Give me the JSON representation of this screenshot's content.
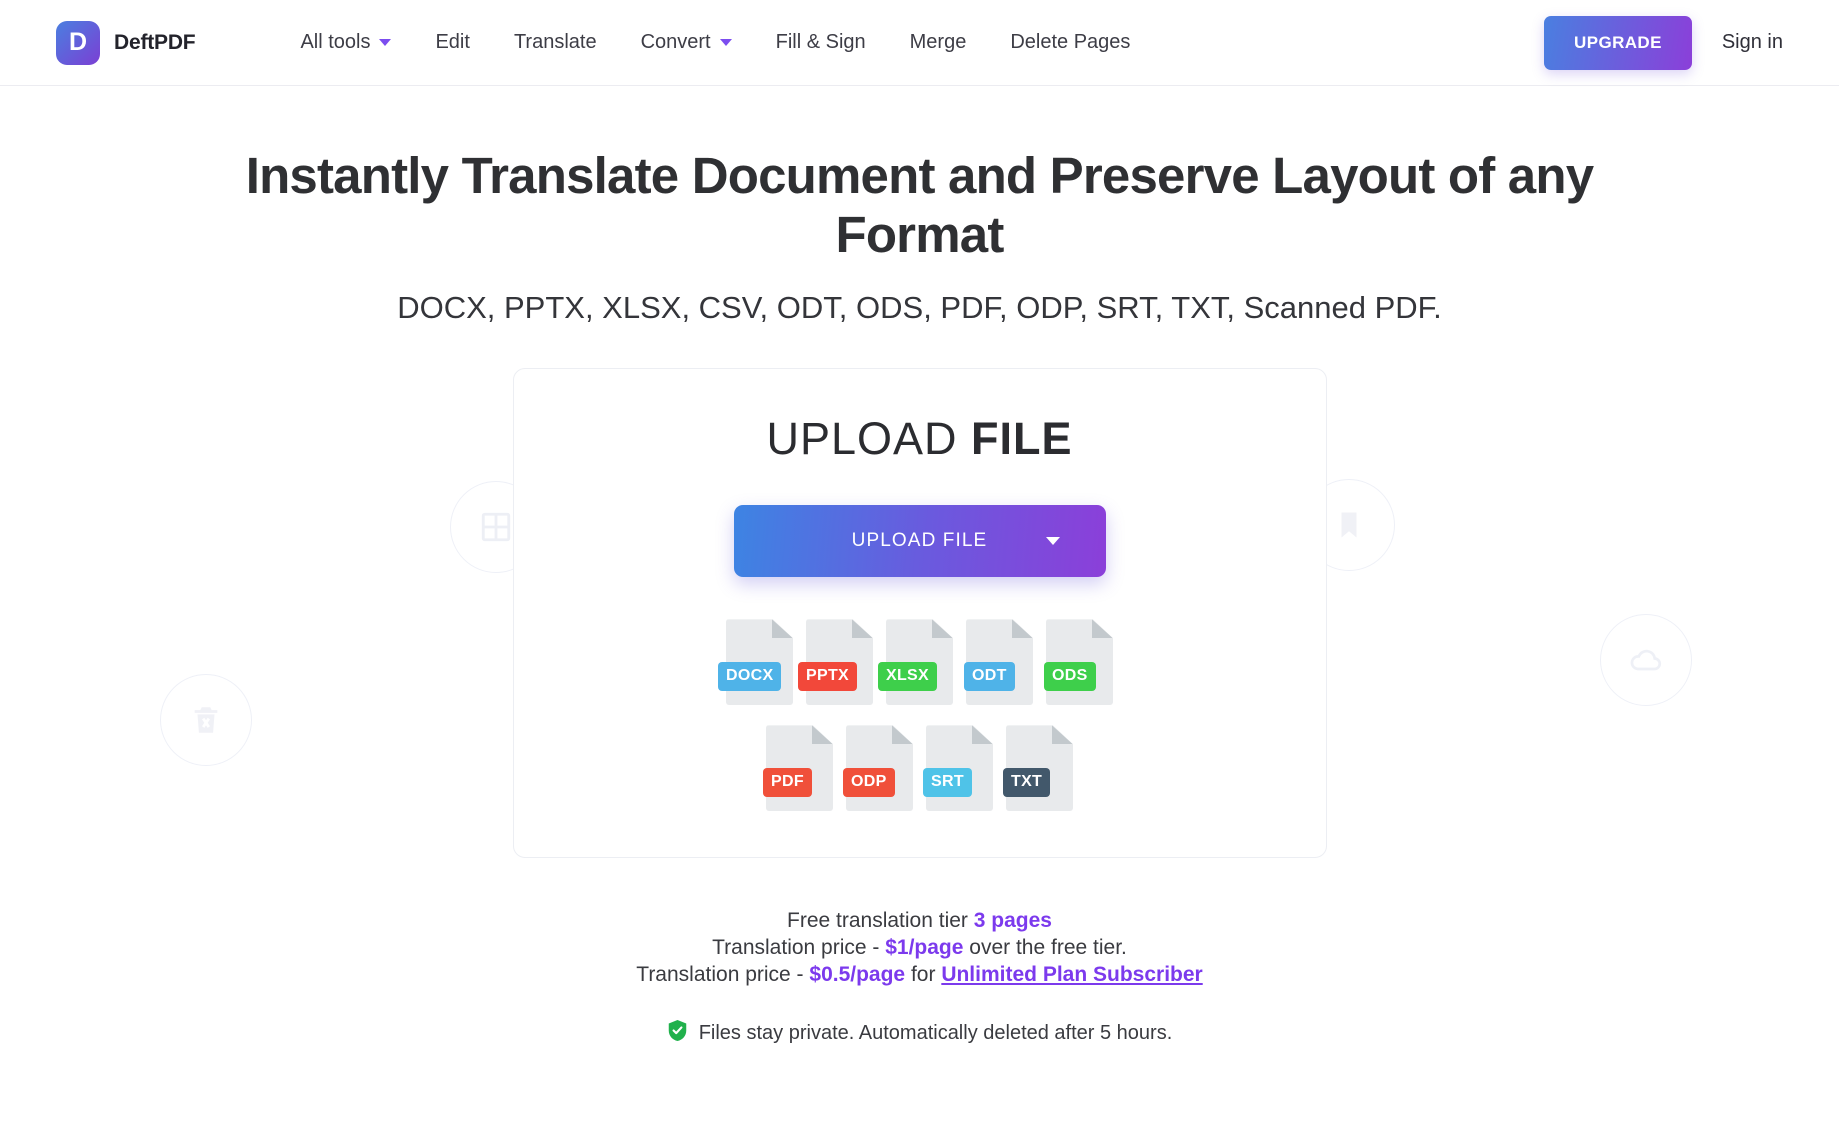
{
  "header": {
    "brand": {
      "mark_letter": "D",
      "name": "DeftPDF"
    },
    "nav": [
      {
        "label": "All tools",
        "has_caret": true,
        "icon": "chevron-down-icon"
      },
      {
        "label": "Edit",
        "has_caret": false,
        "icon": ""
      },
      {
        "label": "Translate",
        "has_caret": false,
        "icon": ""
      },
      {
        "label": "Convert",
        "has_caret": true,
        "icon": "chevron-down-icon"
      },
      {
        "label": "Fill & Sign",
        "has_caret": false,
        "icon": ""
      },
      {
        "label": "Merge",
        "has_caret": false,
        "icon": ""
      },
      {
        "label": "Delete Pages",
        "has_caret": false,
        "icon": ""
      }
    ],
    "upgrade_label": "UPGRADE",
    "signin_label": "Sign in"
  },
  "hero": {
    "title": "Instantly Translate Document and Preserve Layout of any Format",
    "formats_line": "DOCX, PPTX, XLSX, CSV, ODT, ODS, PDF, ODP, SRT, TXT, Scanned PDF."
  },
  "decor_icons": [
    {
      "name": "split-grid-icon"
    },
    {
      "name": "trash-delete-icon"
    },
    {
      "name": "bookmark-icon"
    },
    {
      "name": "cloud-icon"
    },
    {
      "name": "edit-pen-icon"
    }
  ],
  "upload_card": {
    "title_light": "UPLOAD",
    "title_bold": "FILE",
    "button_label": "UPLOAD FILE",
    "dropdown_icon": "chevron-down-icon",
    "file_types_row1": [
      {
        "label": "DOCX",
        "color": "#4FB3E8"
      },
      {
        "label": "PPTX",
        "color": "#F2483A"
      },
      {
        "label": "XLSX",
        "color": "#3ECF4B"
      },
      {
        "label": "ODT",
        "color": "#4FB3E8"
      },
      {
        "label": "ODS",
        "color": "#3ECF4B"
      }
    ],
    "file_types_row2": [
      {
        "label": "PDF",
        "color": "#F0503A"
      },
      {
        "label": "ODP",
        "color": "#F0503A"
      },
      {
        "label": "SRT",
        "color": "#4FC3E8"
      },
      {
        "label": "TXT",
        "color": "#42586B"
      }
    ]
  },
  "pricing": {
    "line1_prefix": "Free translation tier ",
    "line1_accent": "3 pages",
    "line2_prefix": "Translation price - ",
    "line2_accent": "$1/page",
    "line2_suffix": " over the free tier.",
    "line3_prefix": "Translation price - ",
    "line3_accent": "$0.5/page",
    "line3_mid": " for ",
    "line3_link": "Unlimited Plan Subscriber",
    "privacy_icon": "shield-check-icon",
    "privacy_text": "Files stay private. Automatically deleted after 5 hours."
  },
  "colors": {
    "accent_purple": "#7C3AED",
    "gradient_start": "#3d84e3",
    "gradient_end": "#8b3fd9",
    "shield_green": "#21B14C"
  }
}
